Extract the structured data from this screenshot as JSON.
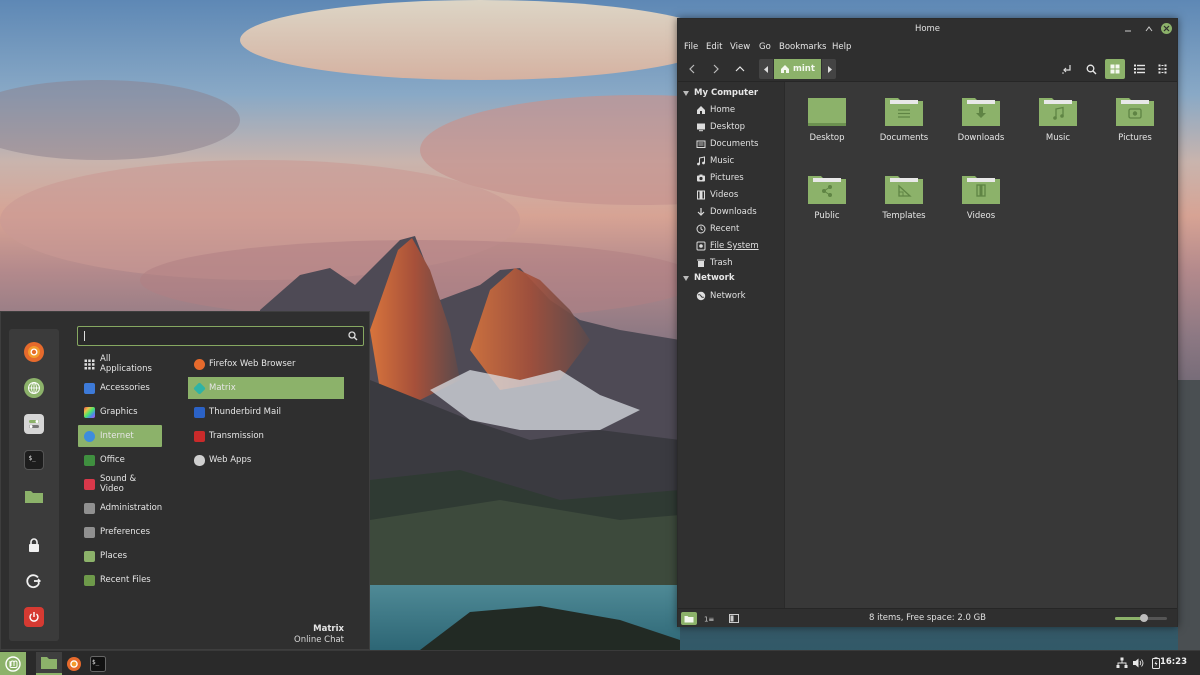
{
  "colors": {
    "accent": "#8cb26a",
    "panel": "#2a2a2a",
    "window": "#383838"
  },
  "menu": {
    "search": {
      "value": "",
      "placeholder": ""
    },
    "favorites": [
      "firefox-icon",
      "web-browser-icon",
      "settings-icon",
      "terminal-icon",
      "folder-icon"
    ],
    "session": [
      "lock-icon",
      "logout-icon",
      "power-icon"
    ],
    "categories": [
      {
        "label": "All Applications",
        "icon": "grid-icon",
        "color": ""
      },
      {
        "label": "Accessories",
        "icon": "accessories-icon",
        "color": "#3d7ad8"
      },
      {
        "label": "Graphics",
        "icon": "graphics-icon",
        "color": "#c458c6"
      },
      {
        "label": "Internet",
        "icon": "internet-icon",
        "color": "#3d8ddd"
      },
      {
        "label": "Office",
        "icon": "office-icon",
        "color": "#3f8f3f"
      },
      {
        "label": "Sound & Video",
        "icon": "sound-video-icon",
        "color": "#d9384a"
      },
      {
        "label": "Administration",
        "icon": "administration-icon",
        "color": "#909090"
      },
      {
        "label": "Preferences",
        "icon": "preferences-icon",
        "color": "#909090"
      },
      {
        "label": "Places",
        "icon": "places-icon",
        "color": "#8cb26a"
      },
      {
        "label": "Recent Files",
        "icon": "recent-files-icon",
        "color": "#6e9a4a"
      }
    ],
    "active_category": 3,
    "apps": [
      {
        "label": "Firefox Web Browser",
        "icon": "firefox-icon",
        "color": "#e66a2c"
      },
      {
        "label": "Matrix",
        "icon": "matrix-icon",
        "color": "#2fb3a5"
      },
      {
        "label": "Thunderbird Mail",
        "icon": "thunderbird-icon",
        "color": "#2b62c6"
      },
      {
        "label": "Transmission",
        "icon": "transmission-icon",
        "color": "#c92a2a"
      },
      {
        "label": "Web Apps",
        "icon": "web-apps-icon",
        "color": "#cfcfcf"
      }
    ],
    "active_app": 1,
    "description": {
      "title": "Matrix",
      "subtitle": "Online Chat"
    }
  },
  "file_manager": {
    "title": "Home",
    "menubar": [
      "File",
      "Edit",
      "View",
      "Go",
      "Bookmarks",
      "Help"
    ],
    "location": "mint",
    "sidebar": {
      "sections": [
        {
          "title": "My Computer",
          "items": [
            {
              "label": "Home",
              "icon": "home-icon"
            },
            {
              "label": "Desktop",
              "icon": "desktop-icon"
            },
            {
              "label": "Documents",
              "icon": "documents-icon"
            },
            {
              "label": "Music",
              "icon": "music-icon"
            },
            {
              "label": "Pictures",
              "icon": "pictures-icon"
            },
            {
              "label": "Videos",
              "icon": "videos-icon"
            },
            {
              "label": "Downloads",
              "icon": "downloads-icon"
            },
            {
              "label": "Recent",
              "icon": "recent-icon"
            },
            {
              "label": "File System",
              "icon": "file-system-icon"
            },
            {
              "label": "Trash",
              "icon": "trash-icon"
            }
          ]
        },
        {
          "title": "Network",
          "items": [
            {
              "label": "Network",
              "icon": "network-icon"
            }
          ]
        }
      ]
    },
    "folders": [
      {
        "label": "Desktop",
        "emblem": ""
      },
      {
        "label": "Documents",
        "emblem": "documents"
      },
      {
        "label": "Downloads",
        "emblem": "downloads"
      },
      {
        "label": "Music",
        "emblem": "music"
      },
      {
        "label": "Pictures",
        "emblem": "pictures"
      },
      {
        "label": "Public",
        "emblem": "public"
      },
      {
        "label": "Templates",
        "emblem": "templates"
      },
      {
        "label": "Videos",
        "emblem": "videos"
      }
    ],
    "status": "8 items, Free space: 2.0 GB",
    "zoom_level": 0.55
  },
  "panel": {
    "launchers": [
      "mint-menu-icon",
      "files-icon",
      "firefox-icon",
      "terminal-icon"
    ],
    "tray": [
      "network-icon",
      "volume-icon",
      "battery-icon",
      "notes-icon"
    ],
    "clock": "16:23"
  }
}
